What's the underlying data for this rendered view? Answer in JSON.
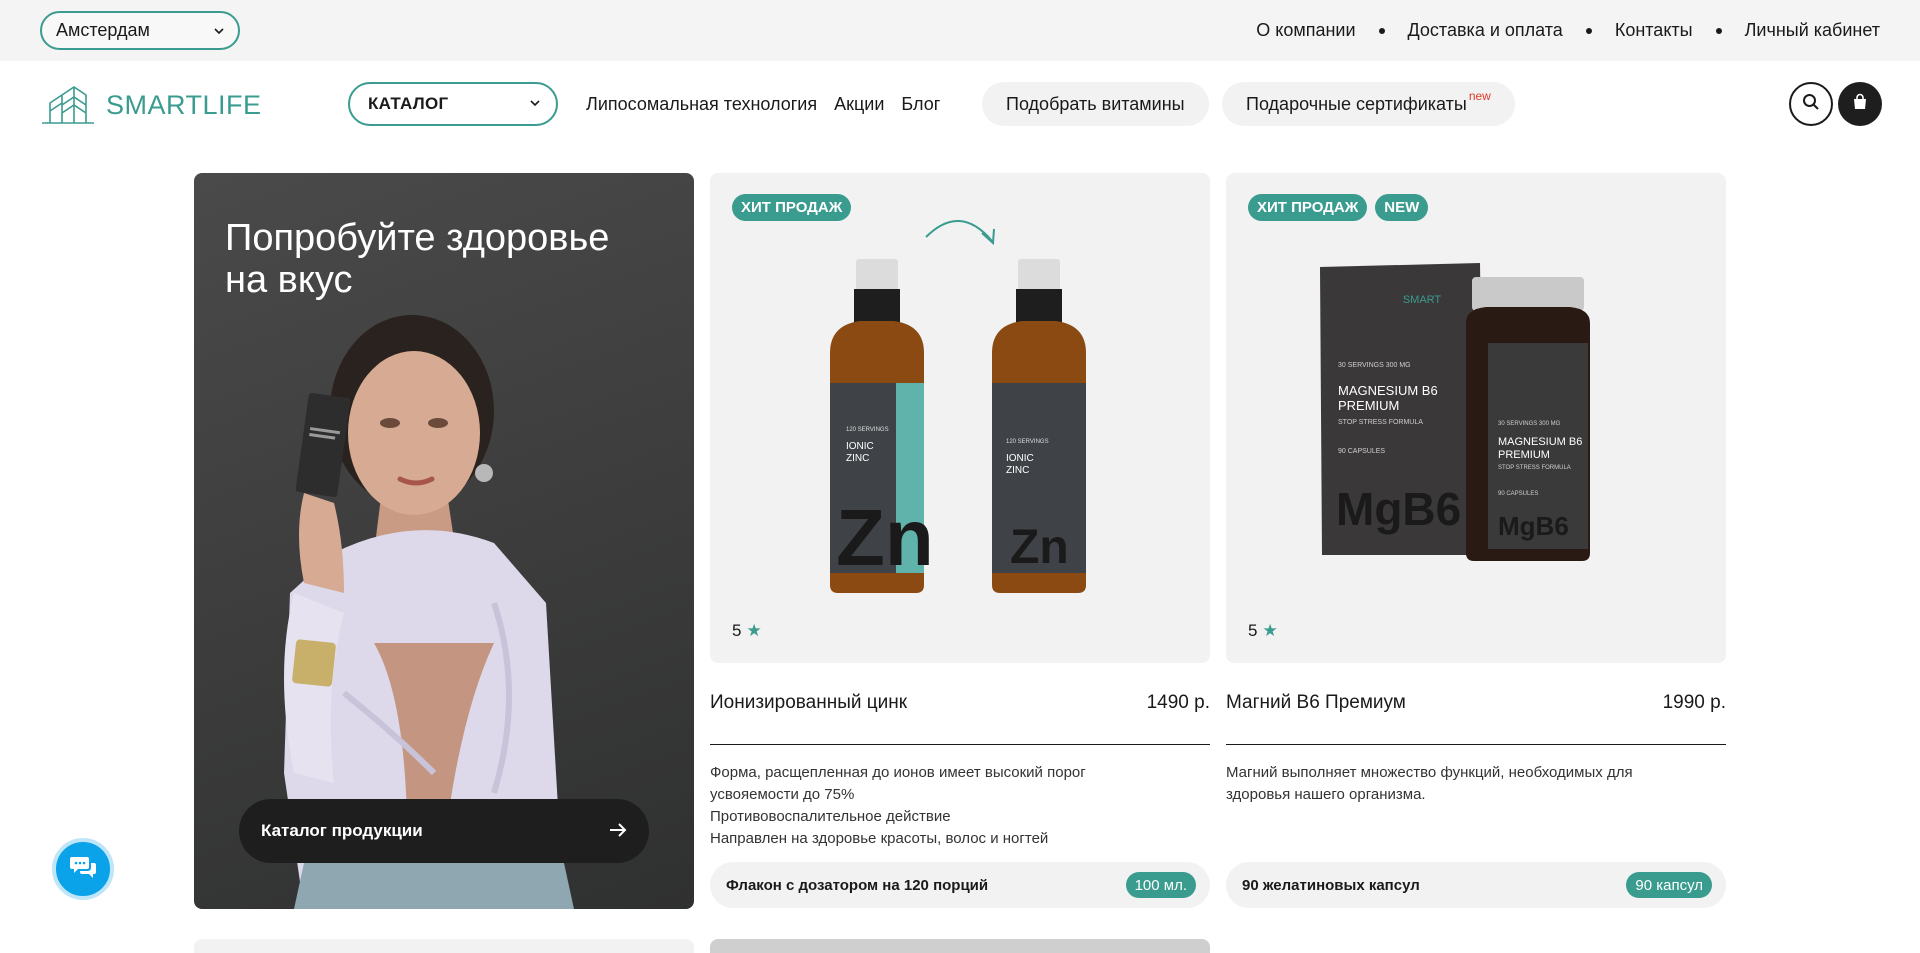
{
  "topbar": {
    "city": "Амстердам",
    "links": [
      "О компании",
      "Доставка и оплата",
      "Контакты",
      "Личный кабинет"
    ]
  },
  "header": {
    "logo_text": "SMARTLIFE",
    "catalog_label": "КАТАЛОГ",
    "nav": [
      "Липосомальная технология",
      "Акции",
      "Блог"
    ],
    "pick_vitamins": "Подобрать витамины",
    "gift_certificates": "Подарочные сертификаты",
    "gift_new": "new"
  },
  "promo": {
    "title": "Попробуйте здоровье на вкус",
    "cta": "Каталог продукции"
  },
  "products": [
    {
      "badges": [
        "ХИТ ПРОДАЖ"
      ],
      "rating": "5",
      "title": "Ионизированный цинк",
      "price": "1490 р.",
      "desc": [
        "Форма, расщепленная до ионов имеет высокий порог усвояемости до 75%",
        "Противовоспалительное действие",
        "Направлен на здоровье красоты, волос и ногтей"
      ],
      "foot": "Флакон с дозатором на 120 порций",
      "foot_badge": "100 мл.",
      "label_lines": [
        "IONIC",
        "ZINC"
      ],
      "big": "Zn",
      "small_top": "120 SERVINGS"
    },
    {
      "badges": [
        "ХИТ ПРОДАЖ",
        "NEW"
      ],
      "rating": "5",
      "title": "Магний B6 Премиум",
      "price": "1990 р.",
      "desc": [
        "Магний выполняет множество функций, необходимых для здоровья нашего организма."
      ],
      "foot": "90 желатиновых капсул",
      "foot_badge": "90 капсул",
      "box_top": "30 SERVINGS   300 MG",
      "box_title_1": "MAGNESIUM B6",
      "box_title_2": "PREMIUM",
      "box_sub": "STOP STRESS FORMULA",
      "box_caps": "90 CAPSULES",
      "big": "MgB6",
      "brand": "SMART"
    }
  ],
  "colors": {
    "accent": "#3a9b8f",
    "chat": "#0aa2e8",
    "dark": "#1e1e1e"
  }
}
